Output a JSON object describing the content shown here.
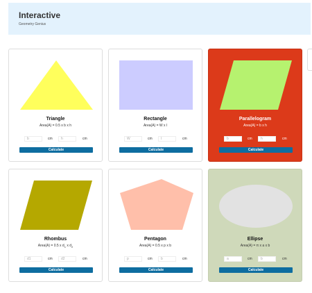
{
  "header": {
    "title": "Interactive",
    "subtitle": "Geometry Genius"
  },
  "cards": [
    {
      "title": "Triangle",
      "formula": "Area(A) = 0.5 x b x h",
      "input1_placeholder": "b",
      "input2_placeholder": "h",
      "unit1": "cm",
      "unit2": "cm",
      "button": "Calculate",
      "shape_color": "#ffff5c"
    },
    {
      "title": "Rectangle",
      "formula": "Area(A) = W x l",
      "input1_placeholder": "W",
      "input2_placeholder": "l",
      "unit1": "cm",
      "unit2": "cm",
      "button": "Calculate",
      "shape_color": "#ccccff"
    },
    {
      "title": "Parallelogram",
      "formula": "Area(A) = b x h",
      "input1_placeholder": "b",
      "input2_placeholder": "h",
      "unit1": "cm",
      "unit2": "cm",
      "button": "Calculate",
      "shape_color": "#b6f26f",
      "card_color": "#dc3a1a"
    },
    {
      "title": "Rhombus",
      "formula": "Area(A) = 0.5 x d",
      "formula_sub1": "1",
      "formula_mid": " x d",
      "formula_sub2": "2",
      "input1_placeholder": "d1",
      "input2_placeholder": "d2",
      "unit1": "cm",
      "unit2": "cm",
      "button": "Calculate",
      "shape_color": "#b5a800"
    },
    {
      "title": "Pentagon",
      "formula": "Area(A) = 0.5 x p x b",
      "input1_placeholder": "p",
      "input2_placeholder": "b",
      "unit1": "cm",
      "unit2": "cm",
      "button": "Calculate",
      "shape_color": "#ffbfaa"
    },
    {
      "title": "Ellipse",
      "formula": "Area(A) = π x a x b",
      "input1_placeholder": "a",
      "input2_placeholder": "b",
      "unit1": "cm",
      "unit2": "cm",
      "button": "Calculate",
      "shape_color": "#e2e2e2",
      "card_color": "#cfd9ba"
    }
  ]
}
